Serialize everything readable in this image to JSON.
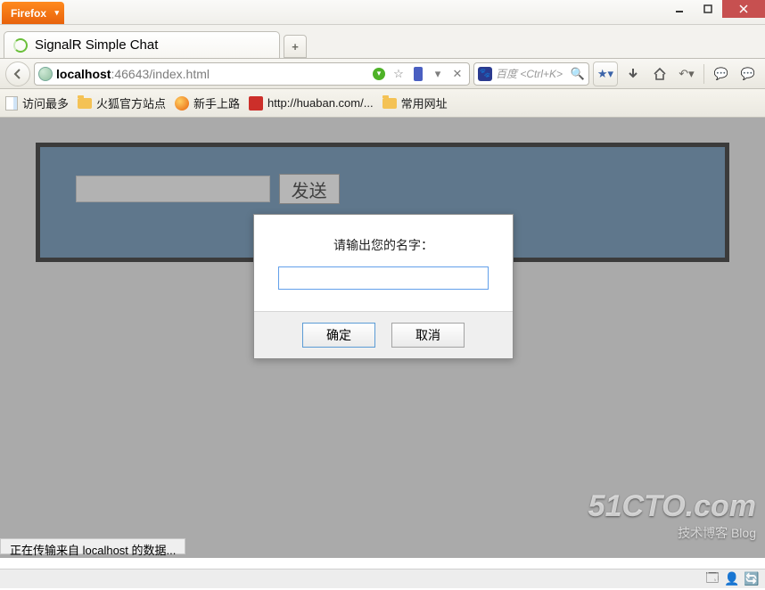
{
  "browser": {
    "name": "Firefox",
    "tab_title": "SignalR Simple Chat",
    "url_host": "localhost",
    "url_rest": ":46643/index.html",
    "search_placeholder": "百度 <Ctrl+K>"
  },
  "bookmarks": {
    "most_visited": "访问最多",
    "ff_official": "火狐官方站点",
    "getting_started": "新手上路",
    "huaban": "http://huaban.com/...",
    "common": "常用网址"
  },
  "chat": {
    "send_label": "发送"
  },
  "modal": {
    "prompt": "请输出您的名字：",
    "ok": "确定",
    "cancel": "取消"
  },
  "status": "正在传输来自 localhost 的数据...",
  "watermark": {
    "line1": "51CTO.com",
    "line2": "技术博客  Blog"
  }
}
